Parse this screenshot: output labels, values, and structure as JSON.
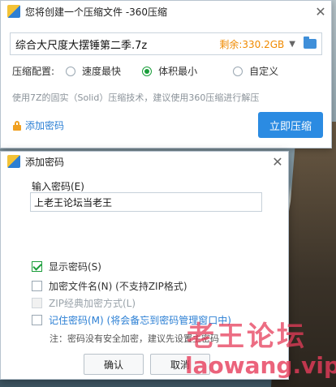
{
  "main_window": {
    "title": "您将创建一个压缩文件 -360压缩",
    "path_value": "综合大尺度大摆锤第二季.7z",
    "free_space": "剩余:330.2GB",
    "config_label": "压缩配置:",
    "options": [
      {
        "label": "速度最快",
        "selected": false
      },
      {
        "label": "体积最小",
        "selected": true
      },
      {
        "label": "自定义",
        "selected": false
      }
    ],
    "hint": "使用7Z的固实（Solid）压缩技术，建议使用360压缩进行解压",
    "add_password": "添加密码",
    "compress_button": "立即压缩"
  },
  "dialog": {
    "title": "添加密码",
    "input_label": "输入密码(E)",
    "password_value": "上老王论坛当老王",
    "checkboxes": [
      {
        "label": "显示密码(S)",
        "checked": true,
        "disabled": false
      },
      {
        "label": "加密文件名(N) (不支持ZIP格式)",
        "checked": false,
        "disabled": false
      },
      {
        "label": "ZIP经典加密方式(L)",
        "checked": false,
        "disabled": true
      },
      {
        "label": "记住密码(M) (将会备忘到密码管理窗口中)",
        "checked": false,
        "disabled": false
      }
    ],
    "note": "注：密码没有安全加密，建议先设置主密码",
    "ok_button": "确认",
    "cancel_button": "取消"
  },
  "watermark": {
    "cn": "老王论坛",
    "url": "laowang.vip"
  },
  "colors": {
    "accent_blue": "#2b8be2",
    "free_space_orange": "#f08a00",
    "radio_green": "#1a9e3a",
    "watermark": "#e63c5a"
  }
}
